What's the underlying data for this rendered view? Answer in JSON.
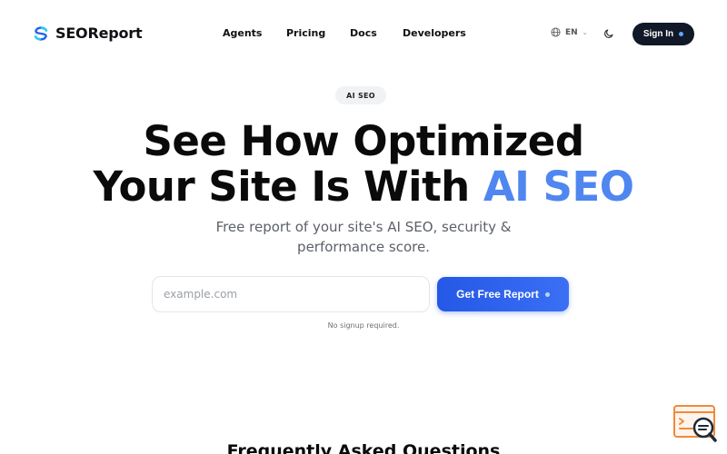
{
  "brand": {
    "name": "SEOReport"
  },
  "nav": {
    "items": [
      {
        "label": "Agents"
      },
      {
        "label": "Pricing"
      },
      {
        "label": "Docs"
      },
      {
        "label": "Developers"
      }
    ],
    "language": "EN",
    "sign_in_label": "Sign In"
  },
  "hero": {
    "badge": "AI SEO",
    "headline_line1": "See How Optimized",
    "headline_line2_prefix": "Your Site Is With ",
    "headline_line2_accent": "AI SEO",
    "subtitle_line1": "Free report of your site's AI SEO, security &",
    "subtitle_line2": "performance score.",
    "input_placeholder": "example.com",
    "cta_label": "Get Free Report",
    "note": "No signup required."
  },
  "faq": {
    "title": "Frequently Asked Questions"
  },
  "colors": {
    "accent": "#4f86f0",
    "cta": "#2458e6",
    "dark": "#111827"
  },
  "icons": {
    "logo": "seoreport-logo-icon",
    "language": "globe-icon",
    "theme": "moon-icon",
    "widget": "code-search-icon"
  }
}
